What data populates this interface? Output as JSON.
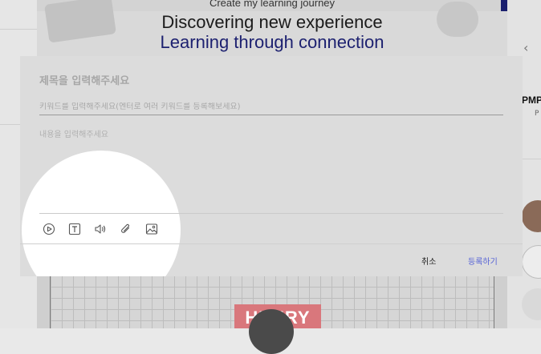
{
  "banner": {
    "caption": "Create my learning journey",
    "title_line1": "Discovering new experience",
    "title_line2": "Learning through connection"
  },
  "side_panel": {
    "prev_arrow_icon": "chevron-left-icon",
    "card_title": "PMP",
    "card_subtitle": "P"
  },
  "video": {
    "badge_text": "HENRY"
  },
  "modal": {
    "title_placeholder": "제목을 입력해주세요",
    "keyword_placeholder": "키워드를 입력해주세요(엔터로 여러 키워드를 등록해보세요)",
    "content_placeholder": "내용을 입력해주세요",
    "toolbar": [
      "video-icon",
      "text-icon",
      "audio-icon",
      "attachment-icon",
      "image-icon"
    ],
    "cancel_label": "취소",
    "submit_label": "등록하기",
    "colors": {
      "submit": "#5562d6",
      "banner_accent": "#1d2170"
    }
  }
}
